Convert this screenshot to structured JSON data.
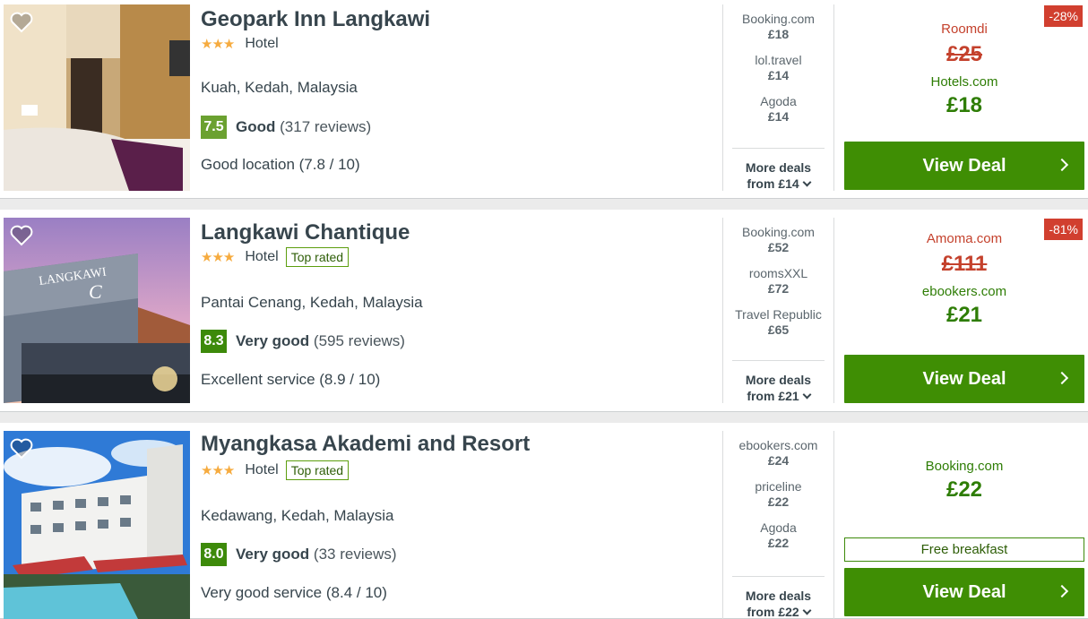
{
  "hotels": [
    {
      "name": "Geopark Inn Langkawi",
      "stars": "★★★",
      "category": "Hotel",
      "top_rated": "",
      "location": "Kuah, Kedah, Malaysia",
      "score": "7.5",
      "rating_word": "Good",
      "reviews": "(317 reviews)",
      "subscore": "Good location (7.8 / 10)",
      "deals": [
        {
          "site": "Booking.com",
          "price": "£18"
        },
        {
          "site": "lol.travel",
          "price": "£14"
        },
        {
          "site": "Agoda",
          "price": "£14"
        }
      ],
      "more_line1": "More deals",
      "more_line2": "from £14",
      "discount": "-28%",
      "orig_site": "Roomdi",
      "orig_price": "£25",
      "best_site": "Hotels.com",
      "best_price": "£18",
      "view_label": "View Deal",
      "colors": {
        "score": "#6ba130"
      }
    },
    {
      "name": "Langkawi Chantique",
      "stars": "★★★",
      "category": "Hotel",
      "top_rated": "Top rated",
      "location": "Pantai Cenang, Kedah, Malaysia",
      "score": "8.3",
      "rating_word": "Very good",
      "reviews": "(595 reviews)",
      "subscore": "Excellent service (8.9 / 10)",
      "deals": [
        {
          "site": "Booking.com",
          "price": "£52"
        },
        {
          "site": "roomsXXL",
          "price": "£72"
        },
        {
          "site": "Travel Republic",
          "price": "£65"
        }
      ],
      "more_line1": "More deals",
      "more_line2": "from £21",
      "discount": "-81%",
      "orig_site": "Amoma.com",
      "orig_price": "£111",
      "best_site": "ebookers.com",
      "best_price": "£21",
      "view_label": "View Deal",
      "colors": {
        "score": "#3d8a0a"
      }
    },
    {
      "name": "Myangkasa Akademi and Resort",
      "stars": "★★★",
      "category": "Hotel",
      "top_rated": "Top rated",
      "location": "Kedawang, Kedah, Malaysia",
      "score": "8.0",
      "rating_word": "Very good",
      "reviews": "(33 reviews)",
      "subscore": "Very good service (8.4 / 10)",
      "deals": [
        {
          "site": "ebookers.com",
          "price": "£24"
        },
        {
          "site": "priceline",
          "price": "£22"
        },
        {
          "site": "Agoda",
          "price": "£22"
        }
      ],
      "more_line1": "More deals",
      "more_line2": "from £22",
      "best_site": "Booking.com",
      "best_price": "£22",
      "free_breakfast": "Free breakfast",
      "view_label": "View Deal",
      "colors": {
        "score": "#3d8a0a"
      }
    }
  ],
  "colors": {
    "accent_green": "#3f8e04",
    "discount_red": "#d13f2f",
    "star": "#f6ab3f"
  }
}
